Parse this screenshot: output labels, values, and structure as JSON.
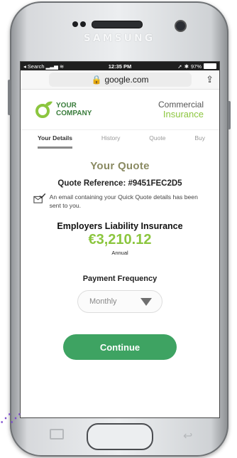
{
  "device": {
    "brand": "SAMSUNG"
  },
  "status_bar": {
    "back_label": "Search",
    "time": "12:35 PM",
    "battery": "97%",
    "battery_fill": 0.97
  },
  "browser": {
    "url": "google.com"
  },
  "header": {
    "logo_line1": "YOUR",
    "logo_line2": "COMPANY",
    "product_line1": "Commercial",
    "product_line2": "Insurance",
    "accent_color": "#8cc63f",
    "logo_color": "#3a7d3c"
  },
  "tabs": [
    {
      "label": "Your Details",
      "active": true
    },
    {
      "label": "History",
      "active": false
    },
    {
      "label": "Quote",
      "active": false
    },
    {
      "label": "Buy",
      "active": false
    }
  ],
  "quote": {
    "title": "Your Quote",
    "reference": "Quote Reference: #9451FEC2D5",
    "email_notice": "An email containing your Quick Quote details has been sent to you.",
    "insurance_type": "Employers Liability  Insurance",
    "price": "€3,210.12",
    "period": "Annual"
  },
  "payment": {
    "label": "Payment Frequency",
    "selected": "Monthly"
  },
  "continue_label": "Continue",
  "button_color": "#3ea362"
}
